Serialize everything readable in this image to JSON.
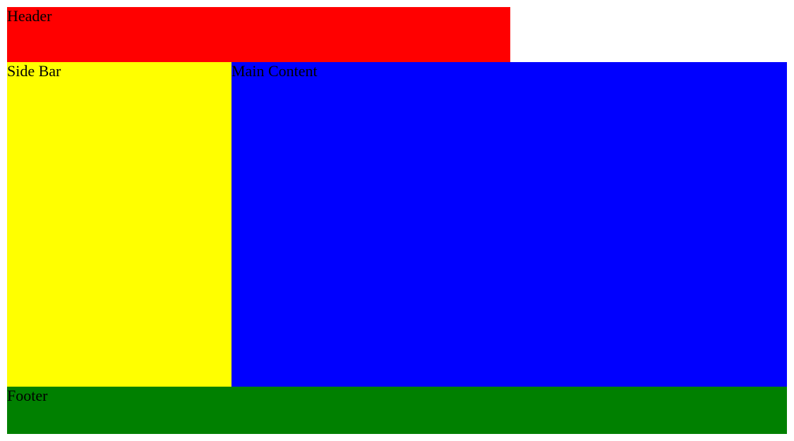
{
  "layout": {
    "header": {
      "label": "Header"
    },
    "sidebar": {
      "label": "Side Bar"
    },
    "main": {
      "label": "Main Content"
    },
    "footer": {
      "label": "Footer"
    }
  },
  "colors": {
    "header": "#ff0000",
    "sidebar": "#ffff00",
    "main": "#0000ff",
    "footer": "#008000"
  }
}
